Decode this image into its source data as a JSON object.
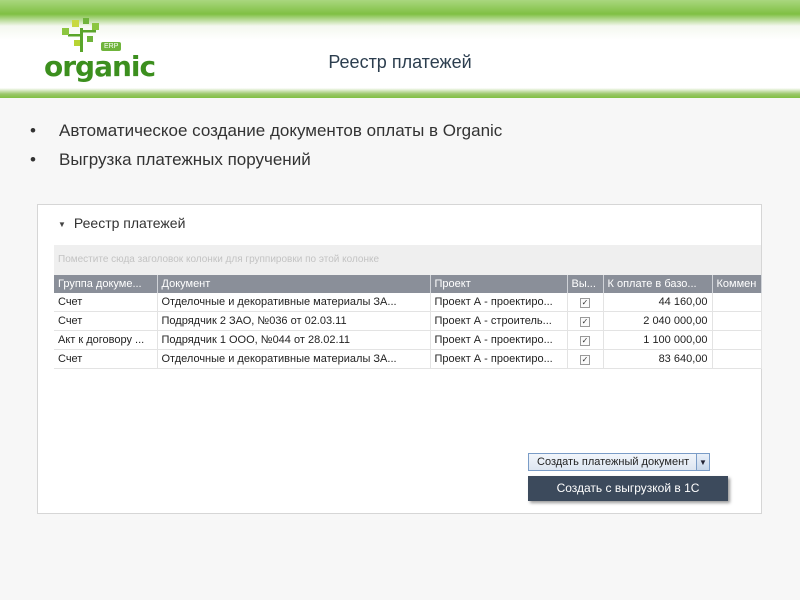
{
  "logo": {
    "word": "organic",
    "badge": "ERP"
  },
  "header": {
    "title": "Реестр платежей"
  },
  "bullets": [
    "Автоматическое создание документов оплаты в Organic",
    "Выгрузка платежных поручений"
  ],
  "panel": {
    "title": "Реестр платежей",
    "group_hint": "Поместите сюда заголовок колонки для группировки по этой колонке"
  },
  "grid": {
    "columns": [
      "Группа докуме...",
      "Документ",
      "Проект",
      "Вы...",
      "К оплате в базо...",
      "Коммен"
    ],
    "rows": [
      {
        "group": "Счет",
        "document": "Отделочные и декоративные материалы ЗА...",
        "project": "Проект А - проектиро...",
        "checked": true,
        "amount": "44 160,00",
        "comment": ""
      },
      {
        "group": "Счет",
        "document": "Подрядчик 2 ЗАО, №036 от 02.03.11",
        "project": "Проект А - строитель...",
        "checked": true,
        "amount": "2 040 000,00",
        "comment": ""
      },
      {
        "group": "Акт к договору ...",
        "document": "Подрядчик 1 ООО, №044 от 28.02.11",
        "project": "Проект А - проектиро...",
        "checked": true,
        "amount": "1 100 000,00",
        "comment": ""
      },
      {
        "group": "Счет",
        "document": "Отделочные и декоративные материалы ЗА...",
        "project": "Проект А - проектиро...",
        "checked": true,
        "amount": "83 640,00",
        "comment": ""
      }
    ]
  },
  "create_button": {
    "label": "Создать платежный документ",
    "arrow_icon": "chevron-down-icon"
  },
  "menu": {
    "item": "Создать с выгрузкой в 1С"
  },
  "colors": {
    "brand_green": "#7fc043",
    "header_gray": "#8a8f99",
    "menu_dark": "#3c4a5c"
  }
}
